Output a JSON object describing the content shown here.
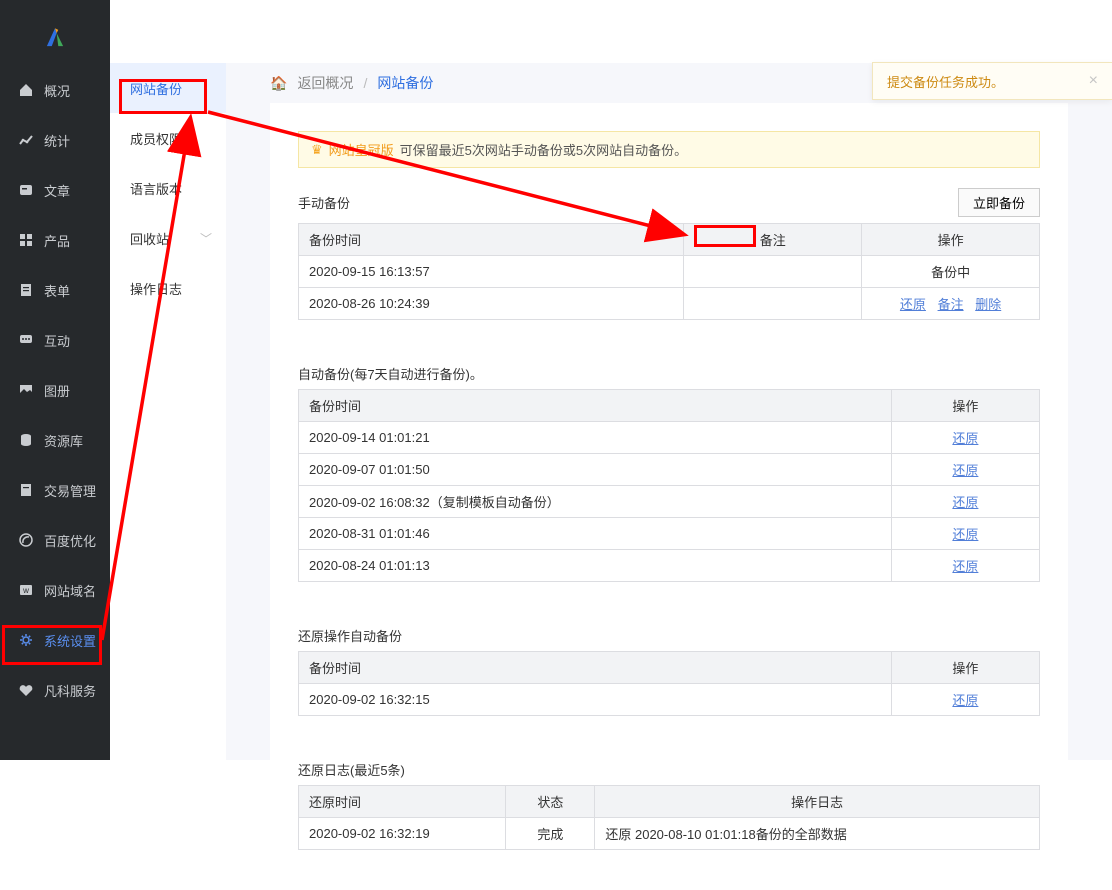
{
  "sidebar": {
    "items": [
      {
        "label": "概况",
        "icon": "home"
      },
      {
        "label": "统计",
        "icon": "stats"
      },
      {
        "label": "文章",
        "icon": "article"
      },
      {
        "label": "产品",
        "icon": "product"
      },
      {
        "label": "表单",
        "icon": "form"
      },
      {
        "label": "互动",
        "icon": "chat"
      },
      {
        "label": "图册",
        "icon": "gallery"
      },
      {
        "label": "资源库",
        "icon": "db"
      },
      {
        "label": "交易管理",
        "icon": "trade"
      },
      {
        "label": "百度优化",
        "icon": "baidu"
      },
      {
        "label": "网站域名",
        "icon": "domain"
      },
      {
        "label": "系统设置",
        "icon": "gear",
        "active": true
      },
      {
        "label": "凡科服务",
        "icon": "heart"
      }
    ]
  },
  "subnav": {
    "items": [
      {
        "label": "网站备份",
        "active": true
      },
      {
        "label": "成员权限"
      },
      {
        "label": "语言版本"
      },
      {
        "label": "回收站",
        "expandable": true
      },
      {
        "label": "操作日志"
      }
    ]
  },
  "crumb": {
    "home": "返回概况",
    "current": "网站备份"
  },
  "notice": {
    "badge": "网站皇冠版",
    "text": " 可保留最近5次网站手动备份或5次网站自动备份。"
  },
  "manual": {
    "title": "手动备份",
    "button": "立即备份",
    "cols": {
      "time": "备份时间",
      "remark": "备注",
      "ops": "操作"
    },
    "rows": [
      {
        "time": "2020-09-15 16:13:57",
        "ops_kind": "backing",
        "ops_text": "备份中"
      },
      {
        "time": "2020-08-26 10:24:39",
        "ops_kind": "links",
        "ops": [
          "还原",
          "备注",
          "删除"
        ]
      }
    ]
  },
  "auto": {
    "title": "自动备份(每7天自动进行备份)。",
    "cols": {
      "time": "备份时间",
      "ops": "操作"
    },
    "rows": [
      {
        "time": "2020-09-14 01:01:21",
        "op": "还原"
      },
      {
        "time": "2020-09-07 01:01:50",
        "op": "还原"
      },
      {
        "time": "2020-09-02 16:08:32（复制模板自动备份）",
        "op": "还原"
      },
      {
        "time": "2020-08-31 01:01:46",
        "op": "还原"
      },
      {
        "time": "2020-08-24 01:01:13",
        "op": "还原"
      }
    ]
  },
  "restore_auto": {
    "title": "还原操作自动备份",
    "cols": {
      "time": "备份时间",
      "ops": "操作"
    },
    "rows": [
      {
        "time": "2020-09-02 16:32:15",
        "op": "还原"
      }
    ]
  },
  "restore_log": {
    "title": "还原日志(最近5条)",
    "cols": {
      "time": "还原时间",
      "status": "状态",
      "log": "操作日志"
    },
    "rows": [
      {
        "time": "2020-09-02 16:32:19",
        "status": "完成",
        "log": "还原 2020-08-10 01:01:18备份的全部数据"
      }
    ]
  },
  "toast": {
    "text": "提交备份任务成功。"
  }
}
